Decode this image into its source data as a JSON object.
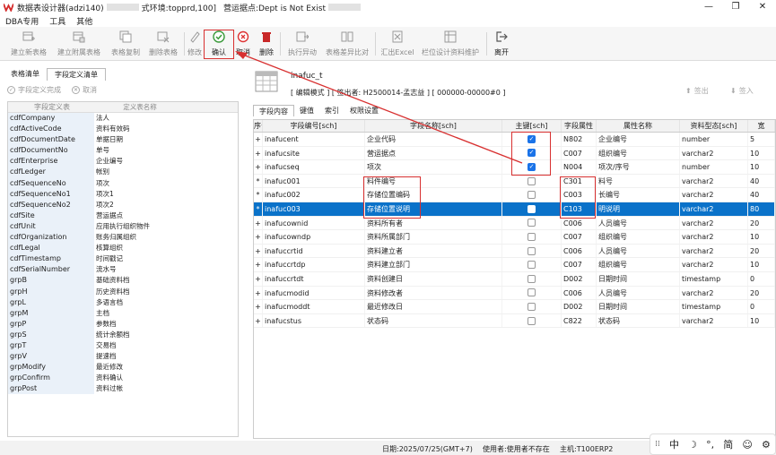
{
  "window": {
    "title_prefix": "数据表设计器(adzi140)",
    "title_env": "式环境:topprd,100]",
    "title_site": "营运据点:Dept is Not Exist",
    "minimize": "—",
    "maximize": "❐",
    "close": "✕"
  },
  "menu": [
    "DBA专用",
    "工具",
    "其他"
  ],
  "toolbar": {
    "new_table": "建立新表格",
    "new_attached": "建立附属表格",
    "copy_table": "表格复制",
    "delete_table": "删除表格",
    "modify": "修改",
    "confirm": "确认",
    "cancel": "取消",
    "delete": "删除",
    "execute": "执行异动",
    "diff": "表格差异比对",
    "export_excel": "汇出Excel",
    "field_maintain": "栏位设计资料维护",
    "leave": "离开"
  },
  "left": {
    "tabs": [
      "表格清单",
      "字段定义清单"
    ],
    "actions": {
      "done": "字段定义完成",
      "cancel": "取消"
    },
    "headers": [
      "字段定义表",
      "定义表名称"
    ],
    "rows": [
      [
        "cdfCompany",
        "法人"
      ],
      [
        "cdfActiveCode",
        "资料有效码"
      ],
      [
        "cdfDocumentDate",
        "单据日期"
      ],
      [
        "cdfDocumentNo",
        "单号"
      ],
      [
        "cdfEnterprise",
        "企业编号"
      ],
      [
        "cdfLedger",
        "帐别"
      ],
      [
        "cdfSequenceNo",
        "项次"
      ],
      [
        "cdfSequenceNo1",
        "项次1"
      ],
      [
        "cdfSequenceNo2",
        "项次2"
      ],
      [
        "cdfSite",
        "营运据点"
      ],
      [
        "cdfUnit",
        "应用执行组织物件"
      ],
      [
        "cdfOrganization",
        "账务归属组织"
      ],
      [
        "cdfLegal",
        "核算组织"
      ],
      [
        "cdfTimestamp",
        "时间戳记"
      ],
      [
        "cdfSerialNumber",
        "流水号"
      ],
      [
        "grpB",
        "基础资料档"
      ],
      [
        "grpH",
        "历史资料档"
      ],
      [
        "grpL",
        "多语言档"
      ],
      [
        "grpM",
        "主档"
      ],
      [
        "grpP",
        "参数档"
      ],
      [
        "grpS",
        "统计余额档"
      ],
      [
        "grpT",
        "交易档"
      ],
      [
        "grpV",
        "提速档"
      ],
      [
        "grpModify",
        "最近修改"
      ],
      [
        "grpConfirm",
        "资料确认"
      ],
      [
        "grpPost",
        "资料过帐"
      ]
    ]
  },
  "right": {
    "table_name": "inafuc_t",
    "info": "[ 编辑模式 ] [ 签出者:  H2500014-孟志益 ] [ 000000-00000#0 ]",
    "checkout": "签出",
    "checkin": "签入",
    "tabs": [
      "字段内容",
      "键值",
      "索引",
      "权限设置"
    ],
    "headers": [
      "序号",
      "字段编号[sch]",
      "字段名称[sch]",
      "主键[sch]",
      "字段属性",
      "属性名称",
      "资料型态[sch]",
      "宽"
    ],
    "rows": [
      {
        "mark": "+",
        "code": "inafucent",
        "name": "企业代码",
        "pk": true,
        "attr": "N802",
        "attr_name": "企业编号",
        "type": "number",
        "w": "5"
      },
      {
        "mark": "+",
        "code": "inafucsite",
        "name": "营运据点",
        "pk": true,
        "attr": "C007",
        "attr_name": "组织编号",
        "type": "varchar2",
        "w": "10"
      },
      {
        "mark": "+",
        "code": "inafucseq",
        "name": "项次",
        "pk": true,
        "attr": "N004",
        "attr_name": "项次/序号",
        "type": "number",
        "w": "10"
      },
      {
        "mark": "*",
        "code": "inafuc001",
        "name": "料件编号",
        "pk": false,
        "attr": "C301",
        "attr_name": "料号",
        "type": "varchar2",
        "w": "40"
      },
      {
        "mark": "*",
        "code": "inafuc002",
        "name": "存储位置编码",
        "pk": false,
        "attr": "C003",
        "attr_name": "长编号",
        "type": "varchar2",
        "w": "40"
      },
      {
        "mark": "*",
        "code": "inafuc003",
        "name": "存储位置说明",
        "pk": false,
        "attr": "C103",
        "attr_name": "明说明",
        "type": "varchar2",
        "w": "80"
      },
      {
        "mark": "+",
        "code": "inafucownid",
        "name": "资料所有者",
        "pk": false,
        "attr": "C006",
        "attr_name": "人员编号",
        "type": "varchar2",
        "w": "20"
      },
      {
        "mark": "+",
        "code": "inafucowndp",
        "name": "资料所属部门",
        "pk": false,
        "attr": "C007",
        "attr_name": "组织编号",
        "type": "varchar2",
        "w": "10"
      },
      {
        "mark": "+",
        "code": "inafuccrtid",
        "name": "资料建立者",
        "pk": false,
        "attr": "C006",
        "attr_name": "人员编号",
        "type": "varchar2",
        "w": "20"
      },
      {
        "mark": "+",
        "code": "inafuccrtdp",
        "name": "资料建立部门",
        "pk": false,
        "attr": "C007",
        "attr_name": "组织编号",
        "type": "varchar2",
        "w": "10"
      },
      {
        "mark": "+",
        "code": "inafuccrtdt",
        "name": "资料创建日",
        "pk": false,
        "attr": "D002",
        "attr_name": "日期时间",
        "type": "timestamp",
        "w": "0"
      },
      {
        "mark": "+",
        "code": "inafucmodid",
        "name": "资料修改者",
        "pk": false,
        "attr": "C006",
        "attr_name": "人员编号",
        "type": "varchar2",
        "w": "20"
      },
      {
        "mark": "+",
        "code": "inafucmoddt",
        "name": "最近修改日",
        "pk": false,
        "attr": "D002",
        "attr_name": "日期时间",
        "type": "timestamp",
        "w": "0"
      },
      {
        "mark": "+",
        "code": "inafucstus",
        "name": "状态码",
        "pk": false,
        "attr": "C822",
        "attr_name": "状态码",
        "type": "varchar2",
        "w": "10"
      }
    ]
  },
  "status": {
    "date": "日期:2025/07/25(GMT+7)",
    "user": "使用者:使用者不存在",
    "host": "主机:T100ERP2"
  },
  "ime": [
    "中",
    "☽",
    "°,",
    "简",
    "☺",
    "⚙"
  ],
  "colors": {
    "accent": "#0a72c9",
    "highlight": "#d83030",
    "checked": "#1a73e8"
  }
}
